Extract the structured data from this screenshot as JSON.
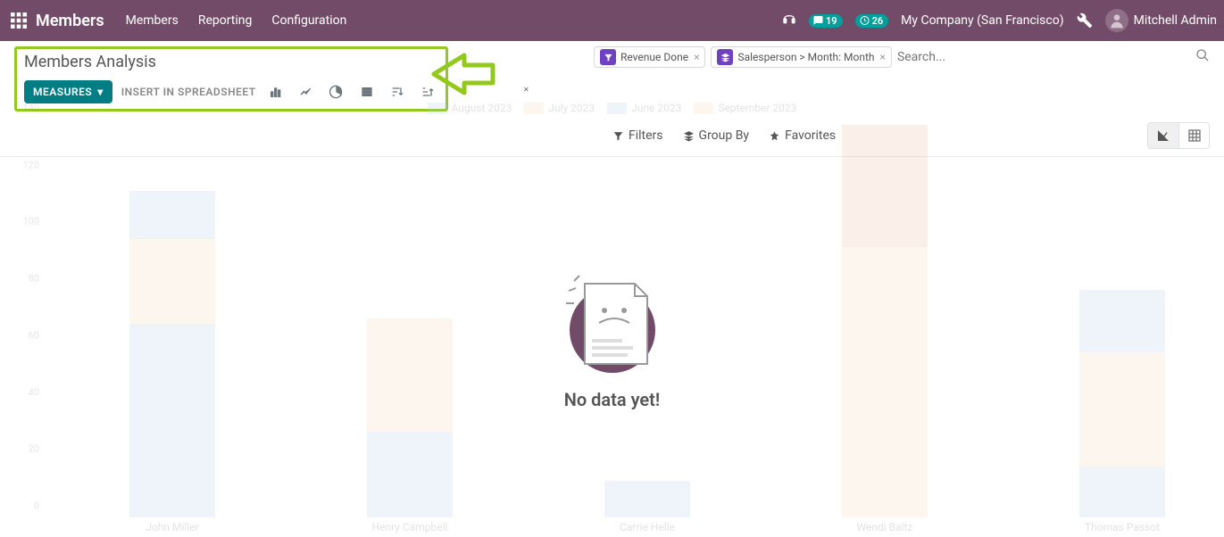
{
  "colors": {
    "brand": "#714B67",
    "accent": "#017E84",
    "badge": "#00A09D",
    "chip": "#6f42c1",
    "highlight": "#92c91c",
    "series_blue": "#a9c7e8",
    "series_orange": "#f7cfa8",
    "salmon_dark": "#e9b08c"
  },
  "navbar": {
    "brand": "Members",
    "menu": [
      "Members",
      "Reporting",
      "Configuration"
    ],
    "discuss_count": "19",
    "activity_count": "26",
    "company": "My Company (San Francisco)",
    "user": "Mitchell Admin"
  },
  "page": {
    "title": "Members Analysis",
    "measures_label": "MEASURES",
    "insert_label": "INSERT IN SPREADSHEET"
  },
  "search": {
    "placeholder": "Search...",
    "filter_chips": [
      {
        "icon": "filter",
        "label": "Revenue Done"
      },
      {
        "icon": "layers",
        "label": "Salesperson > Month: Month"
      }
    ],
    "options": {
      "filters": "Filters",
      "group_by": "Group By",
      "favorites": "Favorites"
    }
  },
  "empty_state": {
    "message": "No data yet!"
  },
  "chart_data": {
    "type": "bar",
    "title": "",
    "xlabel": "",
    "ylabel": "",
    "ylim": [
      0,
      140
    ],
    "yticks": [
      0,
      20,
      40,
      60,
      80,
      100,
      120,
      140
    ],
    "series_legend": [
      "August 2023",
      "July 2023",
      "June 2023",
      "September 2023"
    ],
    "categories": [
      "John Miller",
      "Henry Campbell",
      "Carrie Helle",
      "Wendi Baltz",
      "Thomas Passot"
    ],
    "stacks": [
      {
        "category": "John Miller",
        "bars": [
          {
            "segments": [
              {
                "series": "August 2023",
                "value": 68,
                "color": "series_blue"
              },
              {
                "series": "July 2023",
                "value": 30,
                "color": "series_orange"
              },
              {
                "series": "June 2023",
                "value": 17,
                "color": "series_blue"
              }
            ]
          }
        ]
      },
      {
        "category": "Henry Campbell",
        "bars": [
          {
            "segments": [
              {
                "series": "August 2023",
                "value": 30,
                "color": "series_blue"
              },
              {
                "series": "July 2023",
                "value": 40,
                "color": "series_orange"
              }
            ]
          }
        ]
      },
      {
        "category": "Carrie Helle",
        "bars": [
          {
            "segments": [
              {
                "series": "August 2023",
                "value": 13,
                "color": "series_blue"
              }
            ]
          }
        ]
      },
      {
        "category": "Wendi Baltz",
        "bars": [
          {
            "segments": [
              {
                "series": "July 2023",
                "value": 95,
                "color": "series_orange"
              },
              {
                "series": "September 2023",
                "value": 43,
                "color": "salmon_dark"
              }
            ]
          }
        ]
      },
      {
        "category": "Thomas Passot",
        "bars": [
          {
            "segments": [
              {
                "series": "August 2023",
                "value": 18,
                "color": "series_blue"
              },
              {
                "series": "July 2023",
                "value": 40,
                "color": "series_orange"
              },
              {
                "series": "June 2023",
                "value": 22,
                "color": "series_blue"
              }
            ]
          }
        ]
      }
    ]
  }
}
